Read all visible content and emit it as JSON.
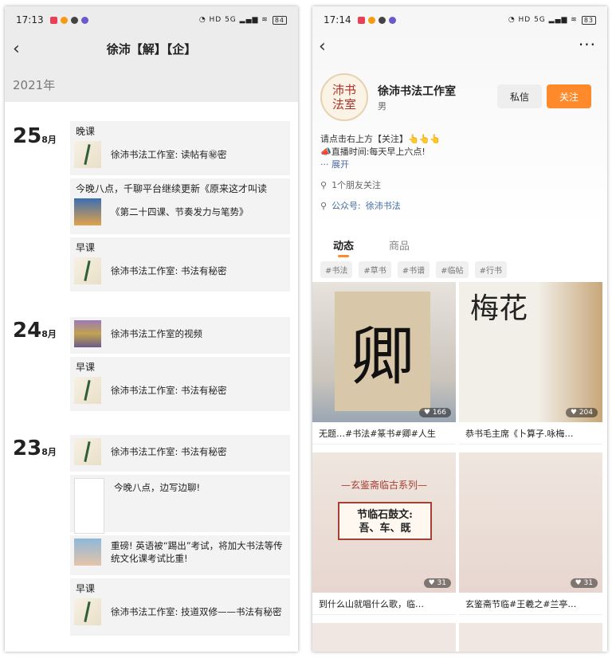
{
  "left": {
    "status": {
      "time": "17:13",
      "battery": "84"
    },
    "title": "徐沛【解】【企】",
    "year": "2021年",
    "groups": [
      {
        "day": "25",
        "month": "8月"
      },
      {
        "day": "24",
        "month": "8月"
      },
      {
        "day": "23",
        "month": "8月"
      }
    ],
    "cards": [
      {
        "tag": "晚课",
        "text": "徐沛书法工作室: 读帖有㊙密"
      },
      {
        "tag": "今晚八点，千聊平台继续更新《原来这才叫读",
        "text": "《第二十四课、节奏发力与笔势》"
      },
      {
        "tag": "早课",
        "text": "徐沛书法工作室: 书法有秘密"
      },
      {
        "text": "徐沛书法工作室的视频"
      },
      {
        "tag": "早课",
        "text": "徐沛书法工作室: 书法有秘密"
      },
      {
        "text": "徐沛书法工作室: 书法有秘密"
      },
      {
        "text": "今晚八点，边写边聊!"
      },
      {
        "text": "重磅! 英语被“踢出”考试，将加大书法等传统文化课考试比重!"
      },
      {
        "tag": "早课",
        "text": "徐沛书法工作室: 技道双修——书法有秘密"
      }
    ]
  },
  "right": {
    "status": {
      "time": "17:14",
      "battery": "83"
    },
    "profile": {
      "name": "徐沛书法工作室",
      "gender": "男",
      "avatar_text": "沛书法室",
      "message_label": "私信",
      "follow_label": "关注"
    },
    "bio": {
      "line1": "请点击右上方【关注】👆👆👆",
      "line2": "📣直播时间:每天早上六点!",
      "expand": "··· 展开"
    },
    "friends": "1个朋友关注",
    "account_prefix": "公众号:",
    "account_name": "徐沛书法",
    "tabs": [
      "动态",
      "商品"
    ],
    "tags": [
      "#书法",
      "#草书",
      "#书谱",
      "#临帖",
      "#行书"
    ],
    "posts": [
      {
        "caption": "无题…#书法#篆书#卿#人生",
        "likes": "166",
        "glyph": "卿"
      },
      {
        "caption": "恭书毛主席《卜算子.咏梅…",
        "likes": "204",
        "glyph": "梅花"
      },
      {
        "caption": "到什么山就唱什么歌，临…",
        "likes": "31",
        "series": "—玄鉴斋临古系列—",
        "box": "节临石鼓文:\n吾、车、既"
      },
      {
        "caption": "玄鉴斋节临#王羲之#兰亭…",
        "likes": "31"
      }
    ]
  }
}
